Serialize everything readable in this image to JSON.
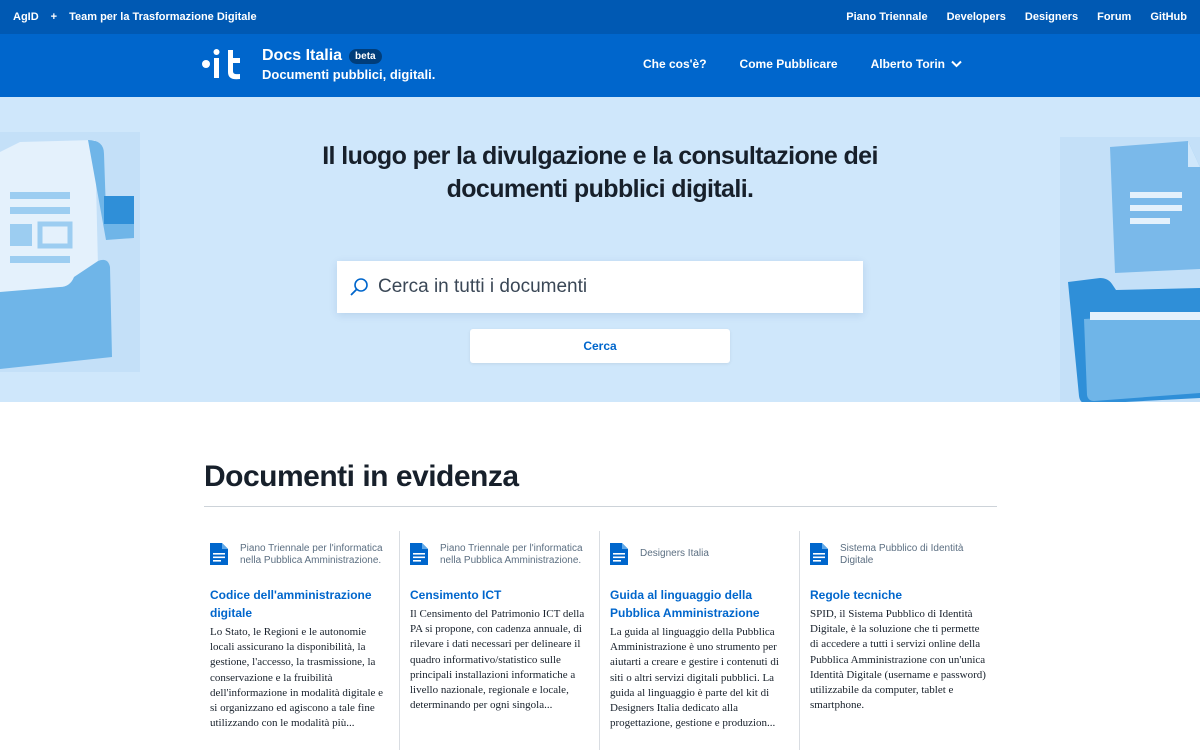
{
  "topbar": {
    "left": [
      "AgID",
      "+",
      "Team per la Trasformazione Digitale"
    ],
    "links": [
      "Piano Triennale",
      "Developers",
      "Designers",
      "Forum",
      "GitHub"
    ]
  },
  "header": {
    "title": "Docs Italia",
    "badge": "beta",
    "subtitle": "Documenti pubblici, digitali.",
    "nav": [
      "Che cos'è?",
      "Come Pubblicare",
      "Alberto Torin"
    ]
  },
  "hero": {
    "title": "Il luogo per la divulgazione e la consultazione dei documenti pubblici digitali.",
    "search_placeholder": "Cerca in tutti i documenti",
    "search_button": "Cerca"
  },
  "featured": {
    "title": "Documenti in evidenza",
    "cards": [
      {
        "category": "Piano Triennale per l'informatica nella Pubblica Amministrazione.",
        "title": "Codice dell'amministrazione digitale",
        "description": "Lo Stato, le Regioni e le autonomie locali assicurano la disponibilità, la gestione, l'accesso, la trasmissione, la conservazione e la fruibilità dell'informazione in modalità digitale e si organizzano ed agiscono a tale fine utilizzando con le modalità più..."
      },
      {
        "category": "Piano Triennale per l'informatica nella Pubblica Amministrazione.",
        "title": "Censimento ICT",
        "description": "Il Censimento del Patrimonio ICT della PA si propone, con cadenza annuale, di rilevare i dati necessari per delineare il quadro informativo/statistico sulle principali installazioni informatiche a livello nazionale, regionale e locale, determinando per ogni singola..."
      },
      {
        "category": "Designers Italia",
        "title": "Guida al linguaggio della Pubblica Amministrazione",
        "description": "La guida al linguaggio della Pubblica Amministrazione è uno strumento per aiutarti a creare e gestire i contenuti di siti o altri servizi digitali pubblici. La guida al linguaggio è parte del kit di Designers Italia dedicato alla progettazione, gestione e produzion..."
      },
      {
        "category": "Sistema Pubblico di Identità Digitale",
        "title": "Regole tecniche",
        "description": "SPID, il Sistema Pubblico di Identità Digitale, è la soluzione che ti permette di accedere a tutti i servizi online della Pubblica Amministrazione con un'unica Identità Digitale (username e password) utilizzabile da computer, tablet e smartphone."
      }
    ]
  },
  "colors": {
    "topbar": "#0059b3",
    "header": "#0066cc",
    "hero_bg": "#cfe7fb",
    "link": "#0066cc"
  },
  "icons": [
    "it-logo",
    "chevron-down-icon",
    "search-icon",
    "document-icon"
  ]
}
